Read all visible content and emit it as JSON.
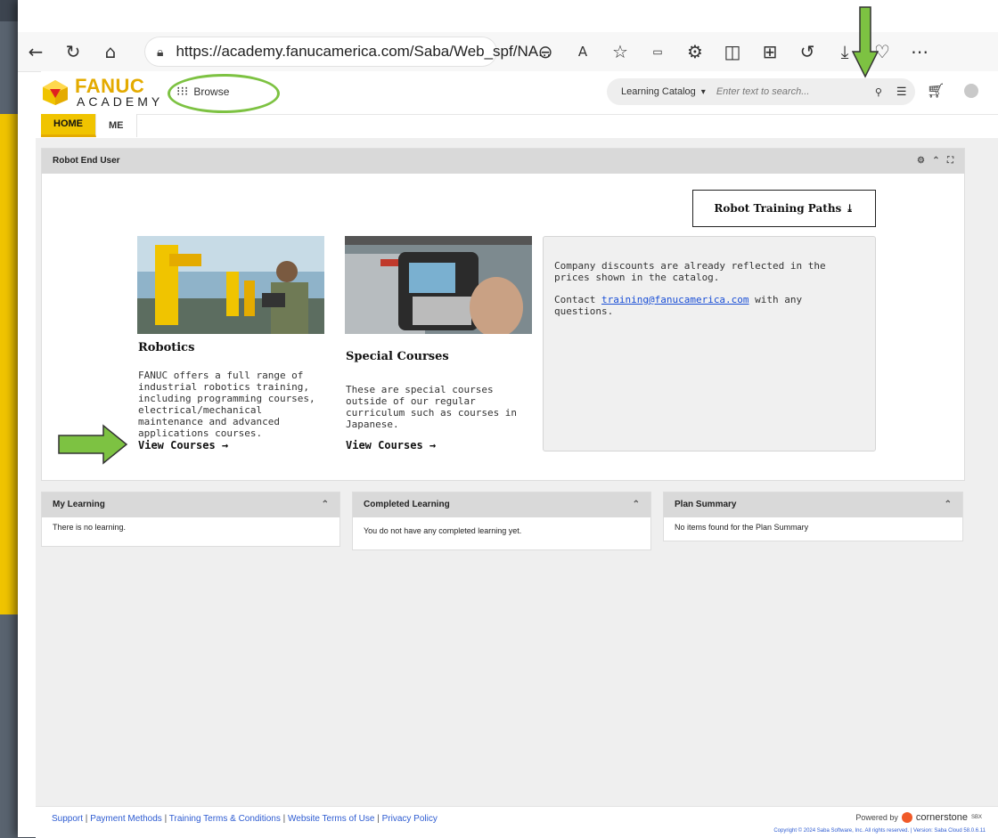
{
  "browser": {
    "url": "https://academy.fanucamerica.com/Saba/Web_spf/NA...",
    "icons": [
      "back-icon",
      "refresh-icon",
      "home-icon",
      "lock-icon",
      "zoom-out-icon",
      "read-aloud-icon",
      "favorite-icon",
      "extension-icon",
      "split-screen-icon",
      "collections-icon",
      "downloads-icon",
      "heart-icon",
      "more-icon"
    ]
  },
  "site": {
    "logo_text": "FANUC",
    "logo_sub": "ACADEMY",
    "browse_label": "Browse",
    "search": {
      "category": "Learning Catalog",
      "placeholder": "Enter text to search..."
    }
  },
  "tabs": [
    {
      "label": "HOME",
      "active": true
    },
    {
      "label": "ME",
      "active": false
    }
  ],
  "main_panel": {
    "title": "Robot End User",
    "paths_button": "Robot Training Paths",
    "cards": [
      {
        "title": "Robotics",
        "description": "FANUC offers a full range of industrial robotics training, including programming courses, electrical/mechanical maintenance and advanced applications courses.",
        "link": "View Courses →"
      },
      {
        "title": "Special Courses",
        "description": "These are special courses outside of our regular curriculum such as courses in Japanese.",
        "link": "View Courses →"
      }
    ],
    "info": {
      "line1": "Company discounts are already reflected in the prices shown in the catalog.",
      "contact_prefix": "Contact ",
      "email": "training@fanucamerica.com",
      "contact_suffix": " with any questions."
    }
  },
  "panels": [
    {
      "title": "My Learning",
      "body": "There is no learning."
    },
    {
      "title": "Completed Learning",
      "body": "You do not have any completed learning yet."
    },
    {
      "title": "Plan Summary",
      "body": "No items found for the Plan Summary"
    }
  ],
  "footer": {
    "links": [
      "Support",
      "Payment Methods",
      "Training Terms & Conditions",
      "Website Terms of Use",
      "Privacy Policy"
    ],
    "powered_by": "Powered by",
    "brand": "cornerstone",
    "brand_sub": "SBX",
    "copyright": "Copyright © 2024 Saba Software, Inc. All rights reserved. | Version: Saba Cloud 58.0.6.11"
  },
  "colors": {
    "accent": "#f0c400",
    "annotation": "#7dc242",
    "link": "#2d5bd1"
  }
}
